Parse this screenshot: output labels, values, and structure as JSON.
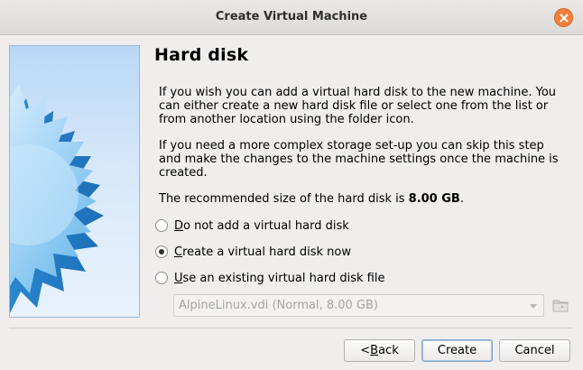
{
  "window": {
    "title": "Create Virtual Machine"
  },
  "page": {
    "heading": "Hard disk",
    "paragraph1": "If you wish you can add a virtual hard disk to the new machine. You can either create a new hard disk file or select one from the list or from another location using the folder icon.",
    "paragraph2": "If you need a more complex storage set-up you can skip this step and make the changes to the machine settings once the machine is created.",
    "recommended_prefix": "The recommended size of the hard disk is ",
    "recommended_size": "8.00 GB",
    "recommended_suffix": "."
  },
  "options": [
    {
      "mnemonic": "D",
      "label_rest": "o not add a virtual hard disk",
      "checked": false
    },
    {
      "mnemonic": "C",
      "label_rest": "reate a virtual hard disk now",
      "checked": true
    },
    {
      "mnemonic": "U",
      "label_rest": "se an existing virtual hard disk file",
      "checked": false
    }
  ],
  "disk_select": {
    "value": "AlpineLinux.vdi (Normal, 8.00 GB)",
    "enabled": false
  },
  "buttons": {
    "back_prefix": "< ",
    "back_mnemonic": "B",
    "back_rest": "ack",
    "create": "Create",
    "cancel": "Cancel"
  },
  "colors": {
    "close_button": "#f0803c",
    "side_image_bg": "#b9d8f6",
    "default_button_border": "#7fa6cd"
  },
  "icons": {
    "close": "close-icon",
    "folder": "folder-icon",
    "wizard_art": "starburst-image",
    "dropdown": "chevron-down-icon"
  }
}
